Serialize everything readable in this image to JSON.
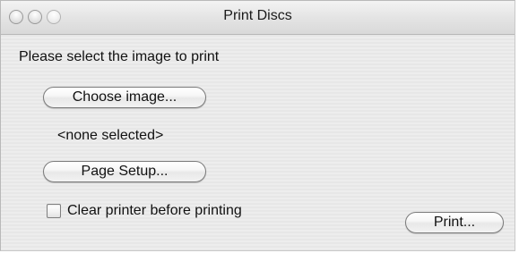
{
  "window": {
    "title": "Print Discs"
  },
  "content": {
    "prompt": "Please select the image to print",
    "choose_button_label": "Choose image...",
    "selected_image": "<none selected>",
    "page_setup_button_label": "Page Setup...",
    "clear_printer_checkbox": {
      "label": "Clear printer before printing",
      "checked": false
    },
    "print_button_label": "Print..."
  }
}
